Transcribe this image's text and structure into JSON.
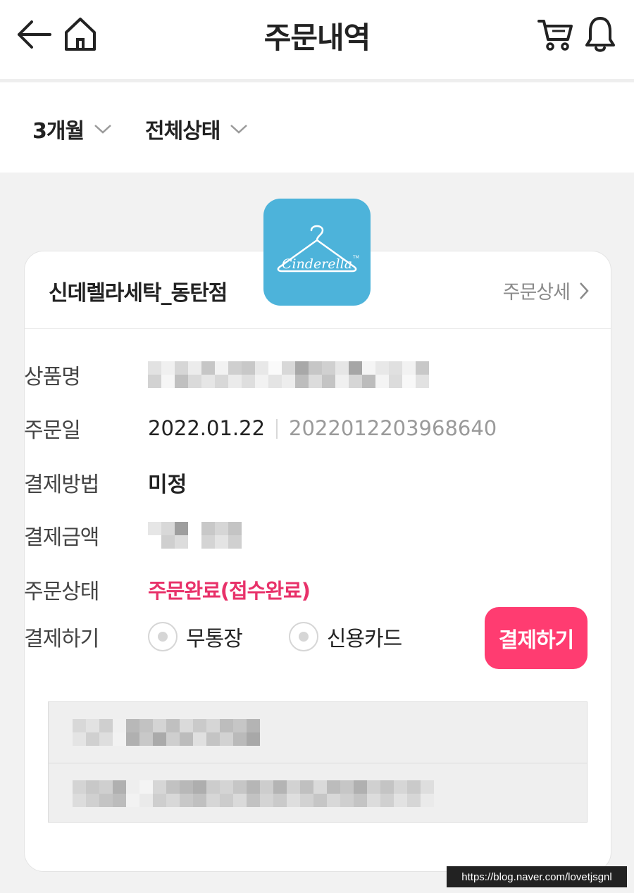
{
  "header": {
    "title": "주문내역",
    "icons": [
      "back-arrow-icon",
      "home-icon",
      "cart-icon",
      "bell-icon"
    ]
  },
  "filters": {
    "period": "3개월",
    "status": "전체상태"
  },
  "order": {
    "store_name": "신데렐라세탁_동탄점",
    "detail_link": "주문상세",
    "logo_text": "Cinderella",
    "labels": {
      "product": "상품명",
      "order_date": "주문일",
      "payment_method": "결제방법",
      "payment_amount": "결제금액",
      "order_status": "주문상태",
      "pay": "결제하기"
    },
    "order_date": "2022.01.22",
    "order_number": "2022012203968640",
    "payment_method_value": "미정",
    "order_status_value": "주문완료(접수완료)",
    "pay_options": [
      "무통장",
      "신용카드"
    ],
    "pay_button": "결제하기"
  },
  "colors": {
    "accent": "#ff3c71",
    "status_text": "#e8326a",
    "logo_bg": "#4db3da",
    "background": "#f2f2f2"
  },
  "watermark": "https://blog.naver.com/lovetjsgnl"
}
